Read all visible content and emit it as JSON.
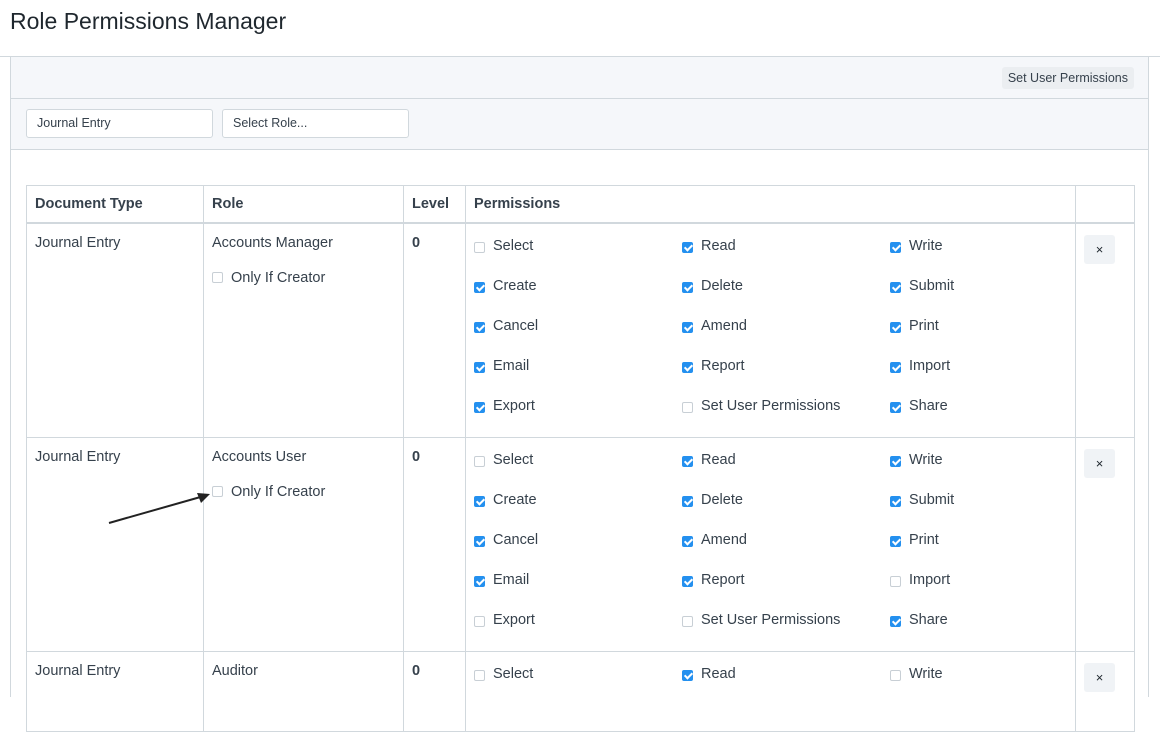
{
  "page": {
    "title": "Role Permissions Manager"
  },
  "actions": {
    "set_user_permissions": "Set User Permissions"
  },
  "filters": {
    "document_type": "Journal Entry",
    "role_placeholder": "Select Role..."
  },
  "table": {
    "headers": [
      "Document Type",
      "Role",
      "Level",
      "Permissions",
      ""
    ],
    "only_if_creator_label": "Only If Creator",
    "remove_icon": "×",
    "rows": [
      {
        "doctype": "Journal Entry",
        "role": "Accounts Manager",
        "level": "0",
        "only_if_creator": false,
        "permissions": [
          {
            "label": "Select",
            "checked": false
          },
          {
            "label": "Read",
            "checked": true
          },
          {
            "label": "Write",
            "checked": true
          },
          {
            "label": "Create",
            "checked": true
          },
          {
            "label": "Delete",
            "checked": true
          },
          {
            "label": "Submit",
            "checked": true
          },
          {
            "label": "Cancel",
            "checked": true
          },
          {
            "label": "Amend",
            "checked": true
          },
          {
            "label": "Print",
            "checked": true
          },
          {
            "label": "Email",
            "checked": true
          },
          {
            "label": "Report",
            "checked": true
          },
          {
            "label": "Import",
            "checked": true
          },
          {
            "label": "Export",
            "checked": true
          },
          {
            "label": "Set User Permissions",
            "checked": false
          },
          {
            "label": "Share",
            "checked": true
          }
        ]
      },
      {
        "doctype": "Journal Entry",
        "role": "Accounts User",
        "level": "0",
        "only_if_creator": false,
        "permissions": [
          {
            "label": "Select",
            "checked": false
          },
          {
            "label": "Read",
            "checked": true
          },
          {
            "label": "Write",
            "checked": true
          },
          {
            "label": "Create",
            "checked": true
          },
          {
            "label": "Delete",
            "checked": true
          },
          {
            "label": "Submit",
            "checked": true
          },
          {
            "label": "Cancel",
            "checked": true
          },
          {
            "label": "Amend",
            "checked": true
          },
          {
            "label": "Print",
            "checked": true
          },
          {
            "label": "Email",
            "checked": true
          },
          {
            "label": "Report",
            "checked": true
          },
          {
            "label": "Import",
            "checked": false
          },
          {
            "label": "Export",
            "checked": false
          },
          {
            "label": "Set User Permissions",
            "checked": false
          },
          {
            "label": "Share",
            "checked": true
          }
        ]
      },
      {
        "doctype": "Journal Entry",
        "role": "Auditor",
        "level": "0",
        "permissions": [
          {
            "label": "Select",
            "checked": false
          },
          {
            "label": "Read",
            "checked": true
          },
          {
            "label": "Write",
            "checked": false
          }
        ]
      }
    ]
  },
  "colors": {
    "accent": "#2490ef",
    "border": "#d1d8dd",
    "panel_bg": "#f5f7fa"
  }
}
